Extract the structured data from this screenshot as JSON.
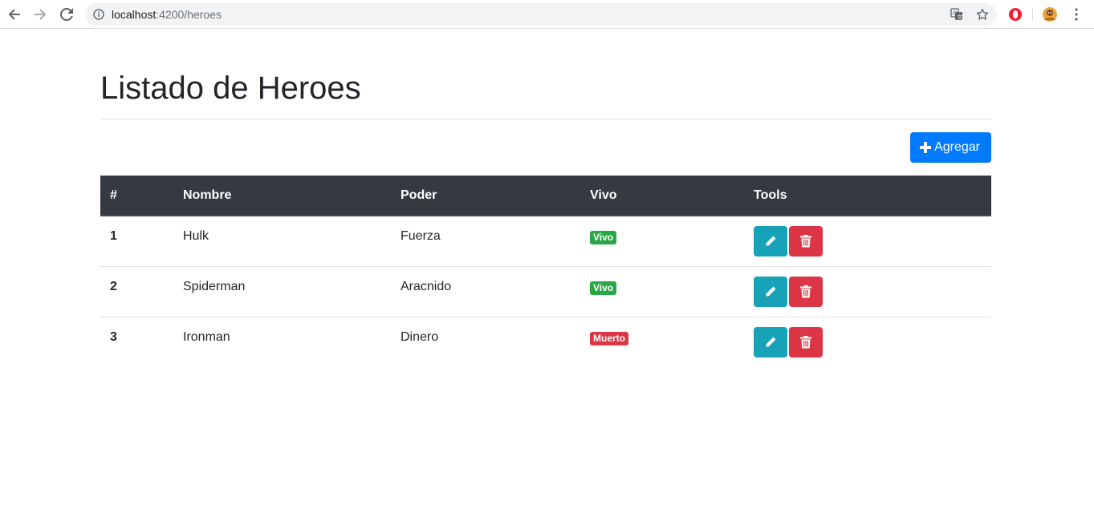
{
  "browser": {
    "url_host": "localhost",
    "url_rest": ":4200/heroes",
    "icons": [
      "back-icon",
      "forward-icon",
      "reload-icon",
      "info-icon",
      "translate-icon",
      "star-icon",
      "opera-extension-icon",
      "profile-avatar",
      "menu-icon"
    ]
  },
  "page": {
    "title": "Listado de Heroes",
    "add_button_label": "Agregar",
    "add_icon": "plus-icon"
  },
  "table": {
    "headers": [
      "#",
      "Nombre",
      "Poder",
      "Vivo",
      "Tools"
    ],
    "rows": [
      {
        "num": "1",
        "name": "Hulk",
        "power": "Fuerza",
        "status": "Vivo",
        "status_type": "success"
      },
      {
        "num": "2",
        "name": "Spiderman",
        "power": "Aracnido",
        "status": "Vivo",
        "status_type": "success"
      },
      {
        "num": "3",
        "name": "Ironman",
        "power": "Dinero",
        "status": "Muerto",
        "status_type": "danger"
      }
    ],
    "tool_icons": [
      "pencil-icon",
      "trash-icon"
    ]
  },
  "colors": {
    "primary": "#007bff",
    "header_dark": "#343a40",
    "success": "#28a745",
    "danger": "#dc3545",
    "info": "#17a2b8"
  }
}
